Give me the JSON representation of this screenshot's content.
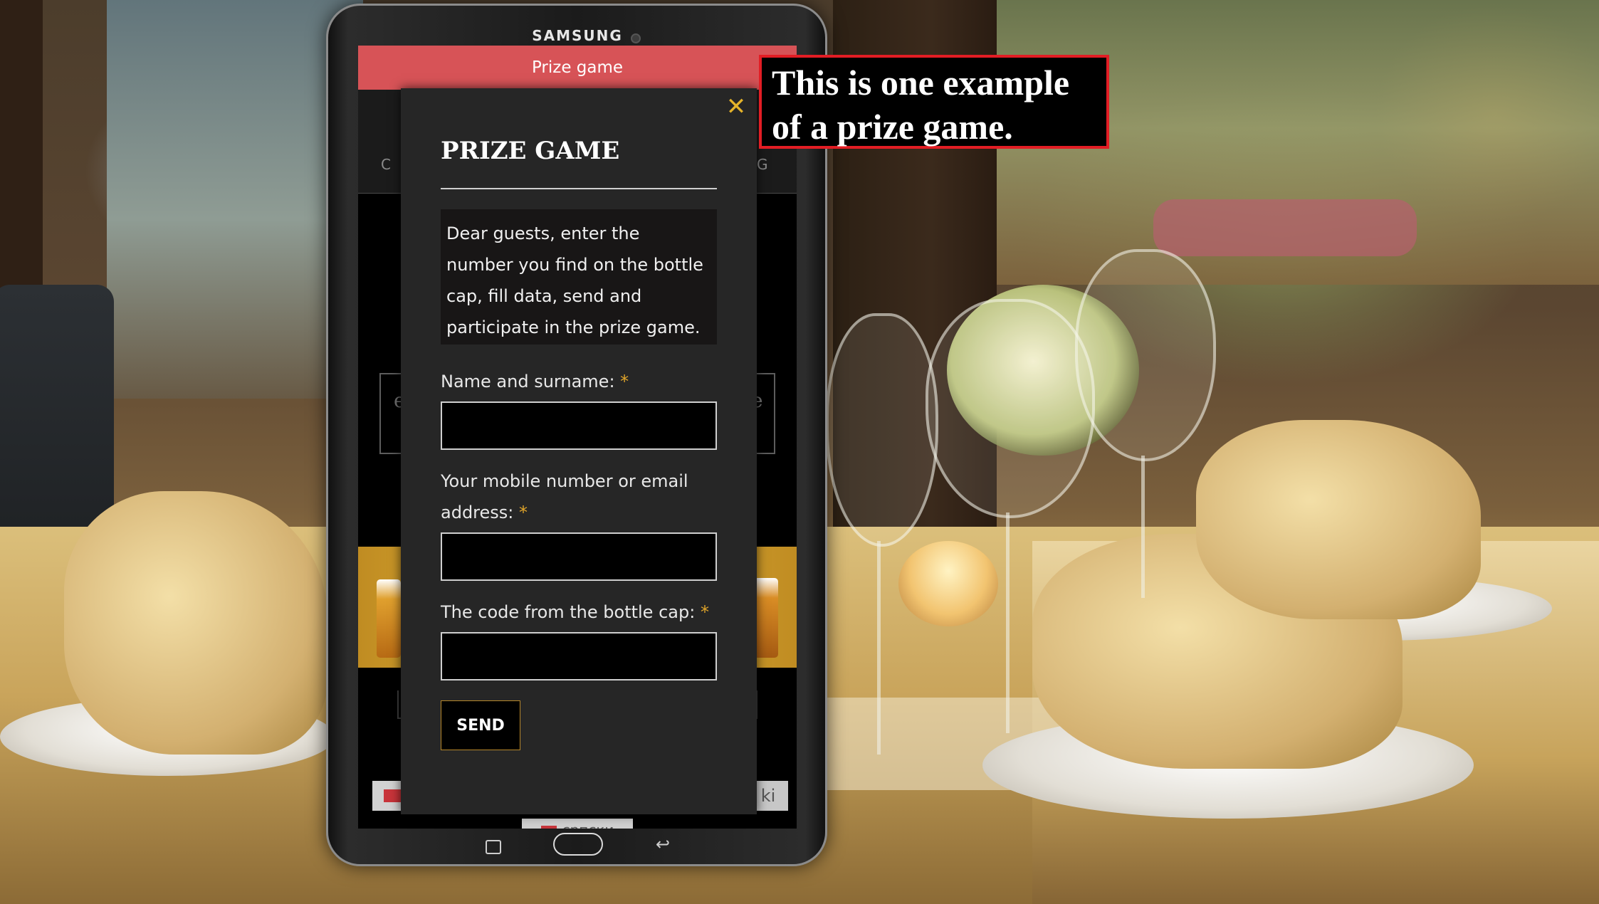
{
  "tablet": {
    "brand": "SAMSUNG",
    "app_bar_title": "Prize game",
    "nav_left_fragment": "C A",
    "nav_right_fragment": "G",
    "banner_left_char": "e",
    "banner_right_char": "e",
    "lang_right_fragment": "ki",
    "lang_serbian_label": "српски"
  },
  "modal": {
    "close_glyph": "✕",
    "title": "PRIZE GAME",
    "note": "Dear guests, enter the number you find on the bottle cap, fill data, send and participate in the prize game.",
    "fields": [
      {
        "label": "Name and surname:",
        "required_mark": "*",
        "value": ""
      },
      {
        "label": "Your mobile number or email address:",
        "required_mark": "*",
        "value": ""
      },
      {
        "label": "The code from the bottle cap:",
        "required_mark": "*",
        "value": ""
      }
    ],
    "send_label": "SEND"
  },
  "callout": {
    "text": "This is one example of a prize game."
  },
  "colors": {
    "app_bar": "#d75357",
    "modal_bg": "#262626",
    "accent_gold": "#e5b32a",
    "callout_border": "#e21d24"
  },
  "icons": [
    "close-icon",
    "recent-apps-icon",
    "home-icon",
    "back-icon",
    "flag-icon"
  ]
}
